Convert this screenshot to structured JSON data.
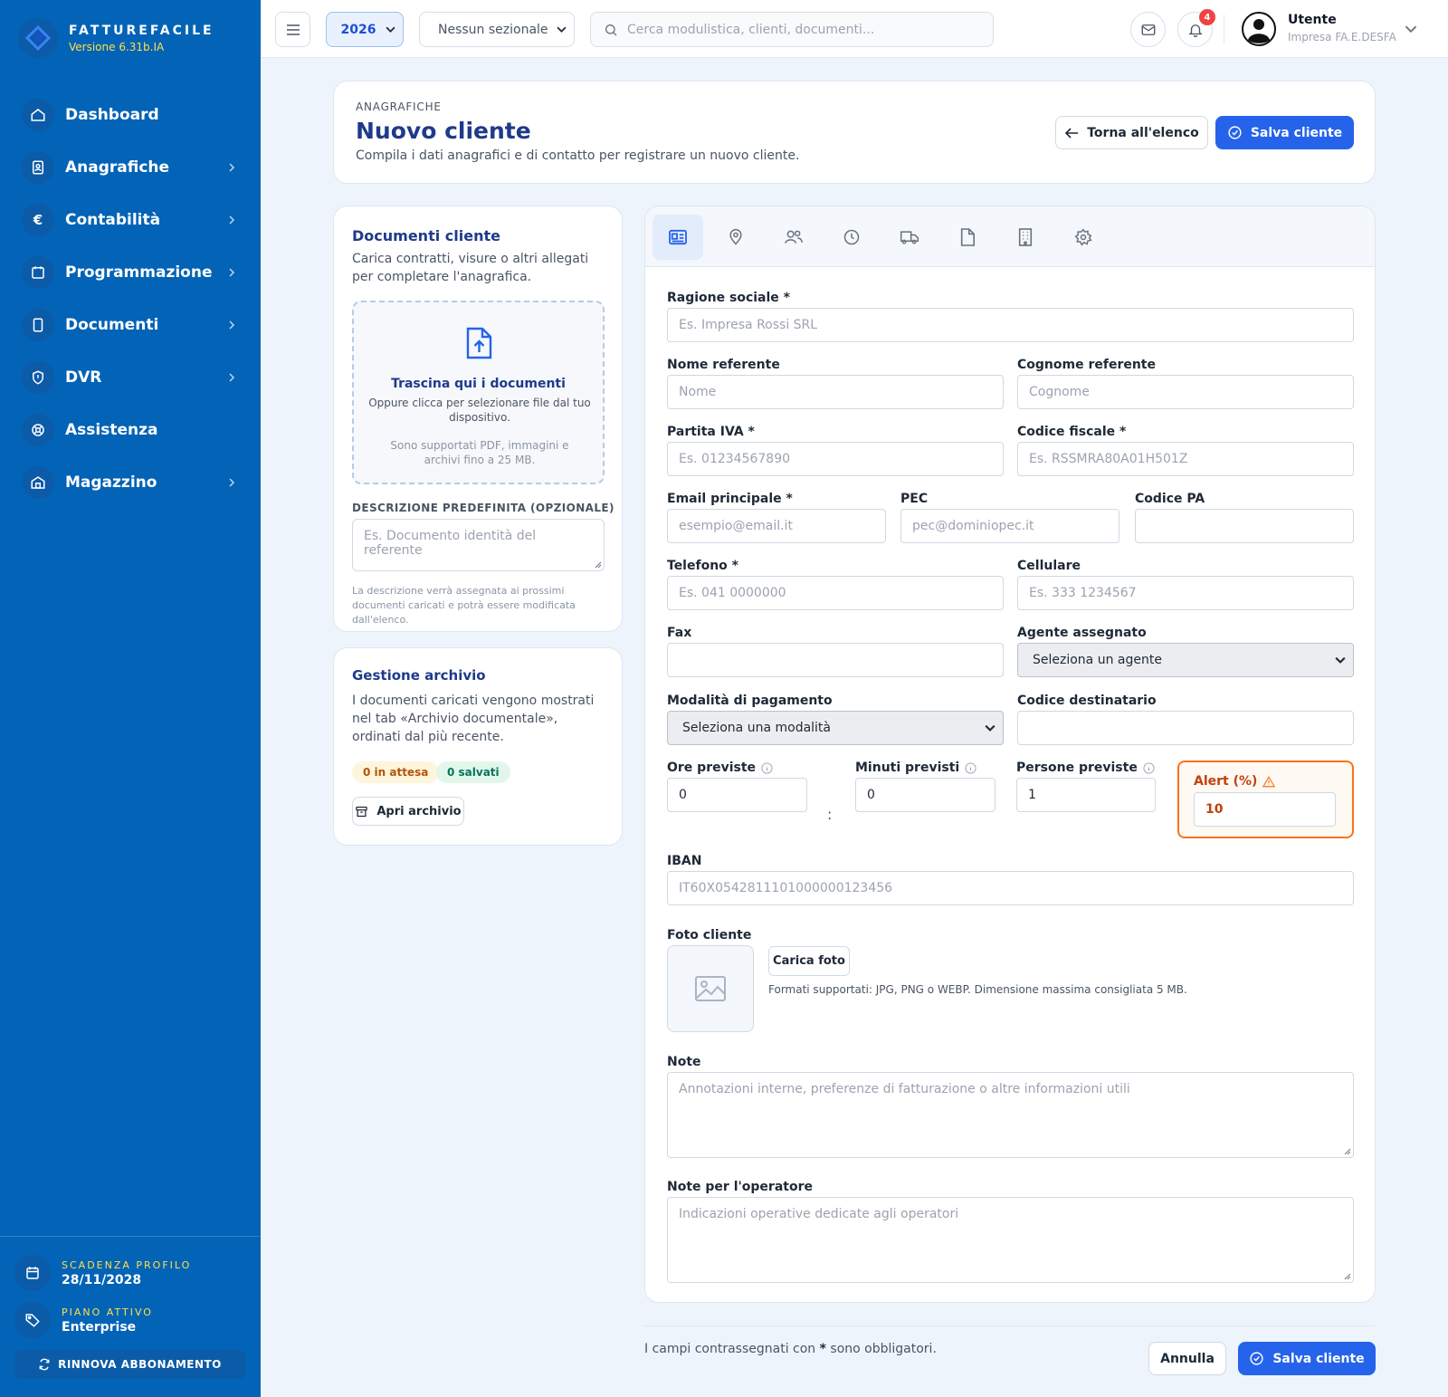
{
  "brand": {
    "name": "FATTUREFACILE",
    "version": "Versione 6.31b.IA"
  },
  "sidebar": {
    "items": [
      {
        "label": "Dashboard",
        "icon": "home-icon",
        "has_submenu": false
      },
      {
        "label": "Anagrafiche",
        "icon": "contact-card-icon",
        "has_submenu": true
      },
      {
        "label": "Contabilità",
        "icon": "euro-icon",
        "has_submenu": true
      },
      {
        "label": "Programmazione",
        "icon": "calendar-icon",
        "has_submenu": true
      },
      {
        "label": "Documenti",
        "icon": "document-icon",
        "has_submenu": true
      },
      {
        "label": "DVR",
        "icon": "shield-icon",
        "has_submenu": true
      },
      {
        "label": "Assistenza",
        "icon": "lifebuoy-icon",
        "has_submenu": false
      },
      {
        "label": "Magazzino",
        "icon": "warehouse-icon",
        "has_submenu": true
      }
    ],
    "expiry": {
      "label": "SCADENZA PROFILO",
      "value": "28/11/2028"
    },
    "plan": {
      "label": "PIANO ATTIVO",
      "value": "Enterprise"
    },
    "renew_label": "RINNOVA ABBONAMENTO"
  },
  "topbar": {
    "year": "2026",
    "sezionale": "Nessun sezionale",
    "search_placeholder": "Cerca modulistica, clienti, documenti...",
    "notifications_count": "4",
    "user_name": "Utente",
    "user_company": "Impresa FA.E.DESFA"
  },
  "header": {
    "eyebrow": "ANAGRAFICHE",
    "title": "Nuovo cliente",
    "subtitle": "Compila i dati anagrafici e di contatto per registrare un nuovo cliente.",
    "back_label": "Torna all'elenco",
    "save_label": "Salva cliente"
  },
  "documents_card": {
    "title": "Documenti cliente",
    "text": "Carica contratti, visure o altri allegati per completare l'anagrafica.",
    "dropzone_title": "Trascina qui i documenti",
    "dropzone_text": "Oppure clicca per selezionare file dal tuo dispositivo.",
    "dropzone_note": "Sono supportati PDF, immagini e archivi fino a 25 MB.",
    "description_label": "DESCRIZIONE PREDEFINITA (OPZIONALE)",
    "description_placeholder": "Es. Documento identità del referente",
    "description_hint": "La descrizione verrà assegnata ai prossimi documenti caricati e potrà essere modificata dall'elenco."
  },
  "archive_card": {
    "title": "Gestione archivio",
    "text": "I documenti caricati vengono mostrati nel tab «Archivio documentale», ordinati dal più recente.",
    "pending_badge": "0 in attesa",
    "saved_badge": "0 salvati",
    "open_label": "Apri archivio"
  },
  "form": {
    "tabs": [
      "id-card-icon",
      "map-pin-icon",
      "users-icon",
      "clock-icon",
      "truck-icon",
      "file-icon",
      "building-icon",
      "settings-icon"
    ],
    "ragione_sociale": {
      "label": "Ragione sociale *",
      "placeholder": "Es. Impresa Rossi SRL"
    },
    "nome_referente": {
      "label": "Nome referente",
      "placeholder": "Nome"
    },
    "cognome_referente": {
      "label": "Cognome referente",
      "placeholder": "Cognome"
    },
    "partita_iva": {
      "label": "Partita IVA *",
      "placeholder": "Es. 01234567890"
    },
    "codice_fiscale": {
      "label": "Codice fiscale *",
      "placeholder": "Es. RSSMRA80A01H501Z"
    },
    "email": {
      "label": "Email principale *",
      "placeholder": "esempio@email.it"
    },
    "pec": {
      "label": "PEC",
      "placeholder": "pec@dominiopec.it"
    },
    "codice_pa": {
      "label": "Codice PA",
      "placeholder": ""
    },
    "telefono": {
      "label": "Telefono *",
      "placeholder": "Es. 041 0000000"
    },
    "cellulare": {
      "label": "Cellulare",
      "placeholder": "Es. 333 1234567"
    },
    "fax": {
      "label": "Fax",
      "placeholder": ""
    },
    "agente": {
      "label": "Agente assegnato",
      "value": "Seleziona un agente"
    },
    "pagamento": {
      "label": "Modalità di pagamento",
      "value": "Seleziona una modalità"
    },
    "codice_destinatario": {
      "label": "Codice destinatario",
      "placeholder": ""
    },
    "ore_previste": {
      "label": "Ore previste",
      "value": "0"
    },
    "minuti_previsti": {
      "label": "Minuti previsti",
      "value": "0"
    },
    "persone_previste": {
      "label": "Persone previste",
      "value": "1"
    },
    "alert": {
      "label": "Alert (%)",
      "value": "10"
    },
    "time_separator": ":",
    "iban": {
      "label": "IBAN",
      "placeholder": "IT60X0542811101000000123456"
    },
    "foto": {
      "label": "Foto cliente",
      "button": "Carica foto",
      "hint": "Formati supportati: JPG, PNG o WEBP. Dimensione massima consigliata 5 MB."
    },
    "note": {
      "label": "Note",
      "placeholder": "Annotazioni interne, preferenze di fatturazione o altre informazioni utili"
    },
    "note_operatore": {
      "label": "Note per l'operatore",
      "placeholder": "Indicazioni operative dedicate agli operatori"
    }
  },
  "footer": {
    "note_before": "I campi contrassegnati con ",
    "note_star": "*",
    "note_after": " sono obbligatori.",
    "cancel_label": "Annulla",
    "save_label": "Salva cliente"
  },
  "colors": {
    "sidebar": "#0363b6",
    "primary": "#2563eb",
    "title": "#1e3a8a",
    "alert": "#f97316",
    "badge_red": "#ef4444"
  }
}
